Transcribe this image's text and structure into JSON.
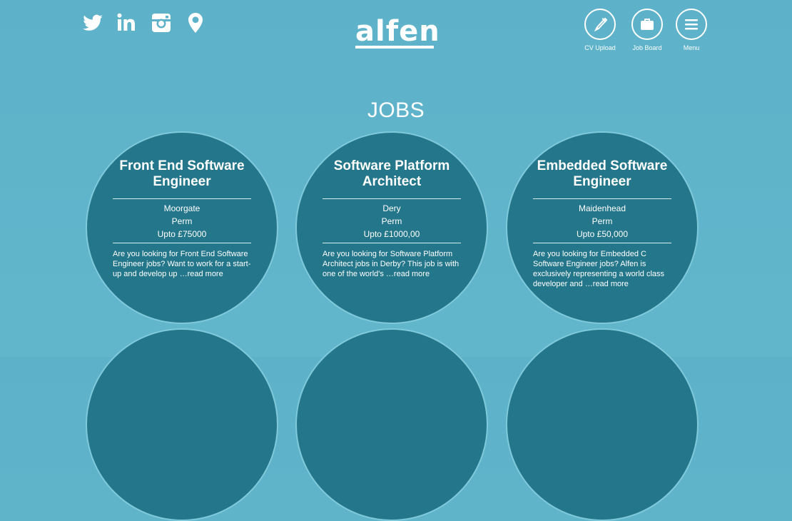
{
  "header": {
    "social_icons": [
      "twitter-icon",
      "linkedin-icon",
      "instagram-icon",
      "location-icon"
    ],
    "logo_text": "alfen",
    "nav": [
      {
        "label": "CV Upload",
        "icon": "pen-nib-icon"
      },
      {
        "label": "Job Board",
        "icon": "briefcase-icon"
      },
      {
        "label": "Menu",
        "icon": "hamburger-icon"
      }
    ]
  },
  "page": {
    "title": "JOBS"
  },
  "jobs": [
    {
      "title": "Front End Software Engineer",
      "location": "Moorgate",
      "type": "Perm",
      "salary": "Upto £75000",
      "description": "Are you looking for Front End Software Engineer jobs? Want to work for a start-up and develop up …read more"
    },
    {
      "title": "Software Platform Architect",
      "location": "Dery",
      "type": "Perm",
      "salary": "Upto £1000,00",
      "description": "Are you looking for Software Platform Architect jobs in Derby? This job is with one of the world's …read more"
    },
    {
      "title": "Embedded Software Engineer",
      "location": "Maidenhead",
      "type": "Perm",
      "salary": "Upto £50,000",
      "description": "Are you looking for Embedded C Software Engineer jobs? Alfen is exclusively representing a world class developer and …read more"
    }
  ],
  "colors": {
    "background": "#5db2c9",
    "card": "#24768a",
    "text": "#ffffff"
  }
}
